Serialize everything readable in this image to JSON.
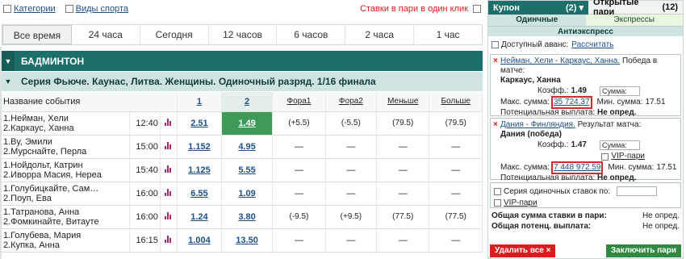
{
  "topbar": {
    "categories": "Категории",
    "sports": "Виды спорта",
    "stakes_one_click": "Ставки в пари в один клик"
  },
  "periods": [
    "Все время",
    "24 часа",
    "Сегодня",
    "12 часов",
    "6 часов",
    "2 часа",
    "1 час"
  ],
  "sport_title": "БАДМИНТОН",
  "tournament_title": "Серия Фьюче. Каунас, Литва. Женщины. Одиночный разряд. 1/16 финала",
  "columns": {
    "name": "Название события",
    "c1": "1",
    "c2": "2",
    "fora1": "Фора1",
    "fora2": "Фора2",
    "less": "Меньше",
    "more": "Больше"
  },
  "events": [
    {
      "p1": "1.Нейман, Хели",
      "p2": "2.Каркаус, Ханна",
      "time": "12:40",
      "o1": "2.51",
      "o2": "1.49",
      "f1h": "(+5.5)",
      "f1": "1.85",
      "f2h": "(-5.5)",
      "f2": "1.85",
      "lh": "(79.5)",
      "l": "1.85",
      "mh": "(79.5)",
      "m": "1.85"
    },
    {
      "p1": "1.Ву, Эмили",
      "p2": "2.Мурснайте, Перла",
      "time": "15:00",
      "o1": "1.152",
      "o2": "4.95",
      "f1h": "—",
      "f1": "",
      "f2h": "—",
      "f2": "",
      "lh": "—",
      "l": "",
      "mh": "—",
      "m": ""
    },
    {
      "p1": "1.Нойдольт, Катрин",
      "p2": "2.Иворра Масия, Нерea",
      "time": "15:40",
      "o1": "1.125",
      "o2": "5.55",
      "f1h": "—",
      "f1": "",
      "f2h": "—",
      "f2": "",
      "lh": "—",
      "l": "",
      "mh": "—",
      "m": ""
    },
    {
      "p1": "1.Голубицкайте, Сам…",
      "p2": "2.Поуп, Ева",
      "time": "16:00",
      "o1": "6.55",
      "o2": "1.09",
      "f1h": "—",
      "f1": "",
      "f2h": "—",
      "f2": "",
      "lh": "—",
      "l": "",
      "mh": "—",
      "m": ""
    },
    {
      "p1": "1.Татранова, Анна",
      "p2": "2.Фомкинайте, Витауте",
      "time": "16:00",
      "o1": "1.24",
      "o2": "3.80",
      "f1h": "(-9.5)",
      "f1": "1.92",
      "f2h": "(+9.5)",
      "f2": "1.79",
      "lh": "(77.5)",
      "l": "1.81",
      "mh": "(77.5)",
      "m": "1.89"
    },
    {
      "p1": "1.Голубева, Мария",
      "p2": "2.Купка, Анна",
      "time": "16:15",
      "o1": "1.004",
      "o2": "13.50",
      "f1h": "—",
      "f1": "",
      "f2h": "—",
      "f2": "",
      "lh": "—",
      "l": "",
      "mh": "—",
      "m": ""
    }
  ],
  "coupon": {
    "tab_coupon": "Купон",
    "tab_coupon_count": "(2) ▾",
    "tab_open": "Открытые пари",
    "tab_open_count": "(12)",
    "sub_single": "Одинчные",
    "sub_express": "Экспрессы",
    "anti_express": "Антиэкспресс",
    "advance_label": "Доступный аванс:",
    "advance_link": "Рассчитать",
    "bet1": {
      "event": "Нейман, Хели - Каркаус, Ханна.",
      "market": "Победа в матче:",
      "pick": "Каркаус, Ханна",
      "coef_label": "Коэфф.:",
      "coef": "1.49",
      "sum_placeholder": "Сумма:",
      "max_label": "Макс. сумма:",
      "max": "35 724.37",
      "min_label": "Мин. сумма:",
      "min": "17.51",
      "payout_label": "Потенциальная выплата:",
      "payout": "Не опред."
    },
    "bet2": {
      "event": "Дания - Финляндия.",
      "market": "Результат матча:",
      "pick": "Дания (победа)",
      "coef_label": "Коэфф.:",
      "coef": "1.47",
      "sum_placeholder": "Сумма:",
      "vip": "VIP-пари",
      "max_label": "Макс. сумма:",
      "max": "7 448 972.59",
      "min_label": "Мин. сумма:",
      "min": "17.51",
      "payout_label": "Потенциальная выплата:",
      "payout": "Не опред."
    },
    "series_label": "Серия одиночных ставок по:",
    "series_vip": "VIP-пари",
    "total_stake_label": "Общая сумма ставки в пари:",
    "total_stake": "Не опред.",
    "total_payout_label": "Общая потенц. выплата:",
    "total_payout": "Не опред.",
    "delete_all": "Удалить все ×",
    "place_bet": "Заключить пари"
  },
  "colors": {
    "accent": "#1c6f6a",
    "highlight": "#3d9a58",
    "danger": "#d71d1d"
  }
}
